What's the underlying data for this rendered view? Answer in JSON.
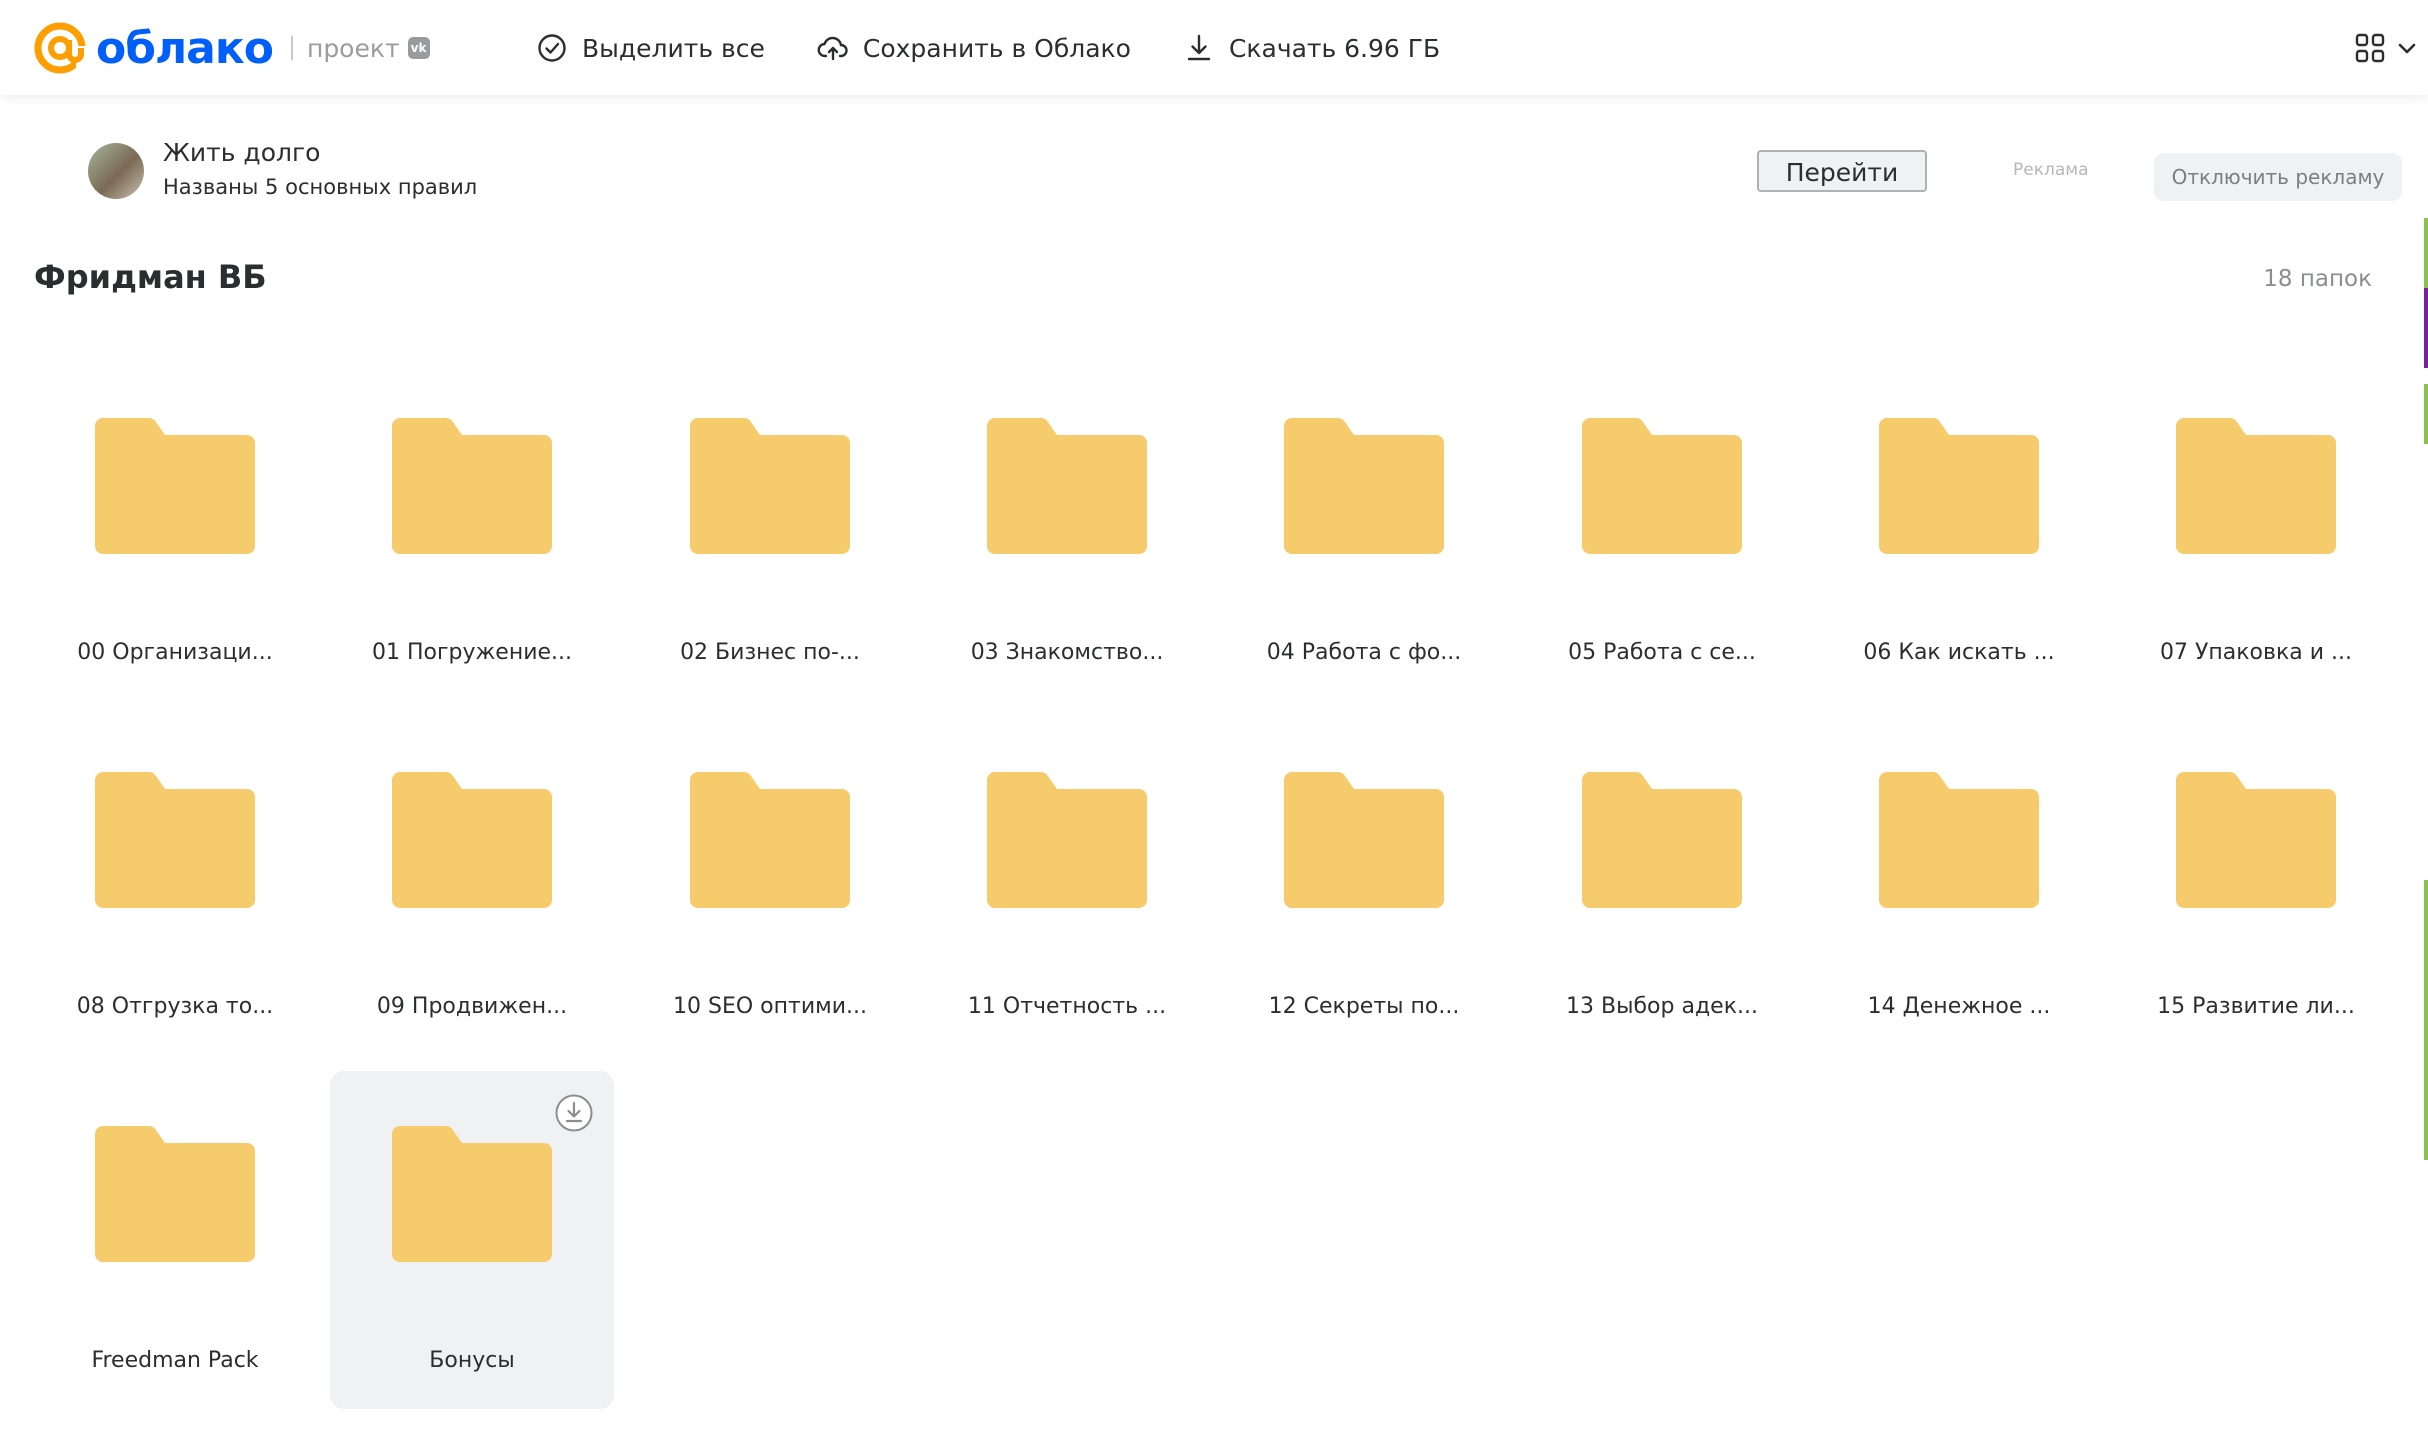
{
  "header": {
    "logo_text": "облако",
    "logo_project": "проект",
    "vk_badge": "vk",
    "toolbar": {
      "select_all": "Выделить все",
      "save_to_cloud": "Сохранить в Облако",
      "download": "Скачать 6.96 ГБ"
    }
  },
  "ad": {
    "title": "Жить долго",
    "subtitle": "Названы 5 основных правил",
    "go_button": "Перейти",
    "label": "Реклама",
    "disable_button": "Отключить рекламу"
  },
  "folder": {
    "title": "Фридман ВБ",
    "count": "18 папок"
  },
  "colors": {
    "brand_blue": "#005ff9",
    "brand_orange": "#ff9e00",
    "folder_yellow": "#f5cb6b",
    "hover_bg": "#f0f1f3"
  },
  "items": [
    {
      "name": "00 Организаци..."
    },
    {
      "name": "01 Погружение..."
    },
    {
      "name": "02 Бизнес по-..."
    },
    {
      "name": "03 Знакомство..."
    },
    {
      "name": "04 Работа с фо..."
    },
    {
      "name": "05 Работа с се..."
    },
    {
      "name": "06 Как искать ..."
    },
    {
      "name": "07 Упаковка и ..."
    },
    {
      "name": "08 Отгрузка то..."
    },
    {
      "name": "09 Продвижен..."
    },
    {
      "name": "10 SEO оптими..."
    },
    {
      "name": "11 Отчетность ..."
    },
    {
      "name": "12 Секреты по..."
    },
    {
      "name": "13 Выбор адек..."
    },
    {
      "name": "14 Денежное ..."
    },
    {
      "name": "15 Развитие ли..."
    },
    {
      "name": "Freedman Pack"
    },
    {
      "name": "Бонусы",
      "hovered": true
    }
  ]
}
